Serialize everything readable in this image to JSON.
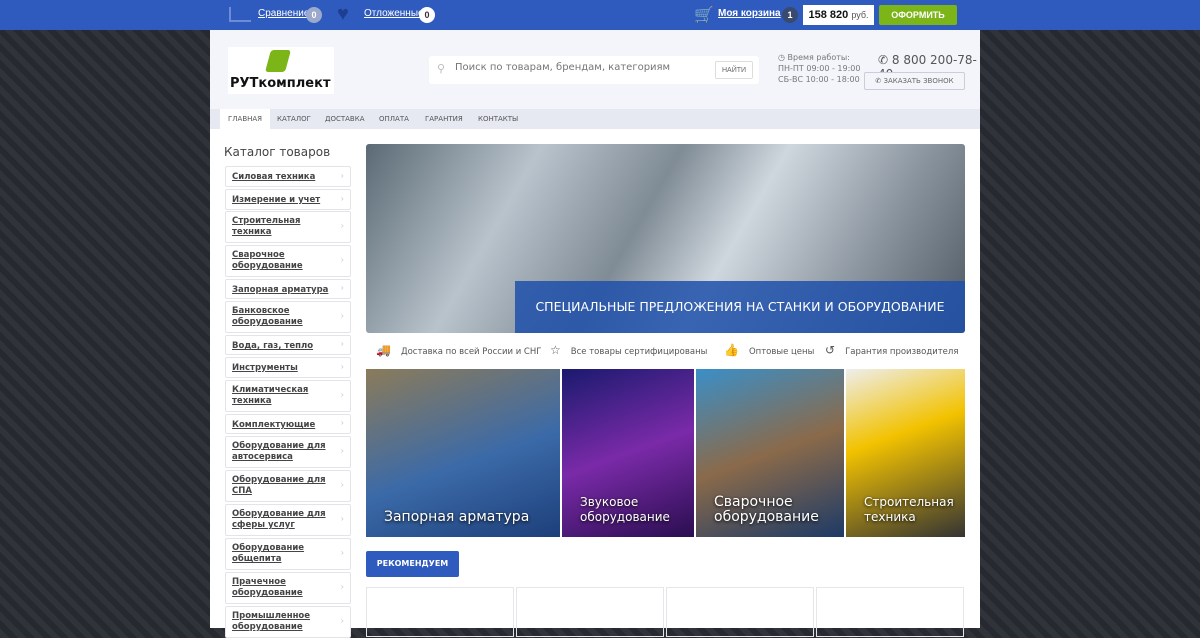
{
  "topbar": {
    "compare_label": "Сравнение",
    "compare_count": "0",
    "favorites_label": "Отложенные",
    "favorites_count": "0",
    "cart_label": "Моя корзина",
    "cart_count": "1",
    "cart_total": "158 820",
    "currency": "руб.",
    "checkout_label": "ОФОРМИТЬ"
  },
  "header": {
    "logo_text": "РУТкомплект",
    "search_placeholder": "Поиск по товарам, брендам, категориям",
    "search_button": "НАЙТИ",
    "hours_title": "Время работы:",
    "hours_weekdays": "ПН-ПТ 09:00 - 19:00",
    "hours_weekend": "СБ-ВС 10:00 - 18:00",
    "phone": "8 800 200-78-40",
    "callback_label": "ЗАКАЗАТЬ ЗВОНОК"
  },
  "nav": [
    "ГЛАВНАЯ",
    "КАТАЛОГ",
    "ДОСТАВКА",
    "ОПЛАТА",
    "ГАРАНТИЯ",
    "КОНТАКТЫ"
  ],
  "sidebar": {
    "title": "Каталог товаров",
    "items": [
      "Силовая техника",
      "Измерение и учет",
      "Строительная техника",
      "Сварочное оборудование",
      "Запорная арматура",
      "Банковское оборудование",
      "Вода, газ, тепло",
      "Инструменты",
      "Климатическая техника",
      "Комплектующие",
      "Оборудование для автосервиса",
      "Оборудование для СПА",
      "Оборудование для сферы услуг",
      "Оборудование общепита",
      "Прачечное оборудование",
      "Промышленное оборудование"
    ]
  },
  "banner": {
    "caption": "СПЕЦИАЛЬНЫЕ ПРЕДЛОЖЕНИЯ НА СТАНКИ И ОБОРУДОВАНИЕ"
  },
  "features": [
    "Доставка по всей России и СНГ",
    "Все товары сертифицированы",
    "Оптовые цены",
    "Гарантия производителя"
  ],
  "tiles": [
    "Запорная арматура",
    "Звуковое оборудование",
    "Сварочное оборудование",
    "Строительная техника"
  ],
  "recommend_label": "РЕКОМЕНДУЕМ",
  "colors": {
    "brand": "#2f5bbf",
    "checkout": "#7cb518"
  }
}
